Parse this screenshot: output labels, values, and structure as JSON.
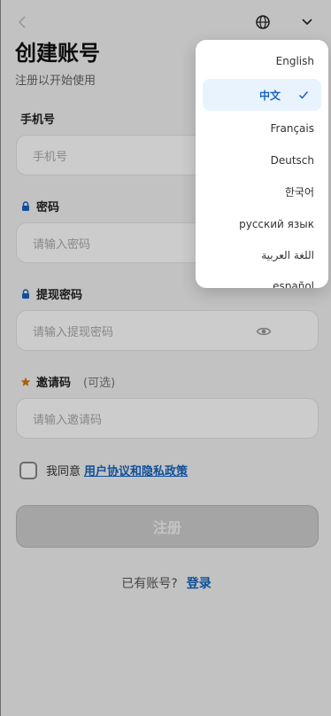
{
  "header": {
    "title": "创建账号",
    "subtitle": "注册以开始使用"
  },
  "form": {
    "phone": {
      "label": "手机号",
      "placeholder": "手机号"
    },
    "password": {
      "label": "密码",
      "placeholder": "请输入密码"
    },
    "withdraw_password": {
      "label": "提现密码",
      "placeholder": "请输入提现密码"
    },
    "invite_code": {
      "label": "邀请码",
      "optional": "(可选)",
      "placeholder": "请输入邀请码"
    }
  },
  "agreement": {
    "text": "我同意",
    "link": "用户协议和隐私政策"
  },
  "register_button": "注册",
  "login_prompt": {
    "text": "已有账号?",
    "link": "登录"
  },
  "language_menu": {
    "items": [
      "English",
      "中文",
      "Français",
      "Deutsch",
      "한국어",
      "русский язык",
      "اللغة العربية",
      "español"
    ],
    "selected": "中文"
  },
  "colors": {
    "accent": "#1565c0",
    "star": "#d97706",
    "selected_bg": "#e9f3fe"
  }
}
